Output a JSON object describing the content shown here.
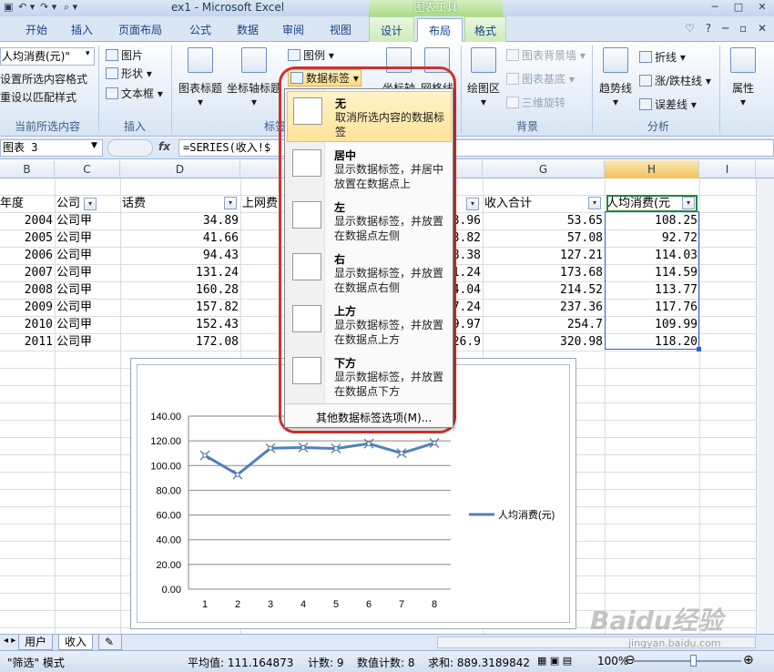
{
  "window": {
    "title": "ex1 - Microsoft Excel",
    "context_tools": "图表工具",
    "controls": [
      "?",
      "─",
      "□",
      "✕"
    ]
  },
  "tabs": [
    {
      "label": "开始"
    },
    {
      "label": "插入"
    },
    {
      "label": "页面布局"
    },
    {
      "label": "公式"
    },
    {
      "label": "数据"
    },
    {
      "label": "审阅"
    },
    {
      "label": "视图"
    },
    {
      "label": "设计"
    },
    {
      "label": "布局"
    },
    {
      "label": "格式"
    }
  ],
  "ribbon": {
    "selection_box": "人均消费(元)\"",
    "format_selection": "设置所选内容格式",
    "reset_style": "重设以匹配样式",
    "group_current": "当前所选内容",
    "picture": "图片",
    "shapes": "形状",
    "textbox": "文本框",
    "group_insert": "插入",
    "chart_title": "图表标题",
    "axis_title": "坐标轴标题",
    "legend": "图例",
    "data_labels": "数据标签",
    "group_labels": "标签",
    "axes": "坐标轴",
    "gridlines": "网格线",
    "plot_area": "绘图区",
    "chart_wall": "图表背景墙",
    "chart_floor": "图表基底",
    "rotation": "三维旋转",
    "group_background": "背景",
    "trendline": "趋势线",
    "lines": "折线",
    "updown": "涨/跌柱线",
    "errorbars": "误差线",
    "group_analysis": "分析",
    "properties": "属性"
  },
  "formula_bar": {
    "name_box": "图表 3",
    "fx": "fx",
    "formula": "=SERIES(收入!$"
  },
  "columns": [
    "B",
    "C",
    "D",
    "",
    "",
    "G",
    "H",
    "I"
  ],
  "table": {
    "headers": {
      "year": "年度",
      "company": "公司",
      "phone": "话费",
      "internet": "上网费",
      "income": "收入合计",
      "per_capita": "人均消费(元"
    },
    "rows": [
      {
        "year": "2004",
        "company": "公司甲",
        "phone": "34.89",
        "partial": "3.96",
        "income": "53.65",
        "per_capita": "108.25"
      },
      {
        "year": "2005",
        "company": "公司甲",
        "phone": "41.66",
        "partial": "3.82",
        "income": "57.08",
        "per_capita": "92.72"
      },
      {
        "year": "2006",
        "company": "公司甲",
        "phone": "94.43",
        "partial": "8.38",
        "income": "127.21",
        "per_capita": "114.03"
      },
      {
        "year": "2007",
        "company": "公司甲",
        "phone": "131.24",
        "partial": "1.24",
        "income": "173.68",
        "per_capita": "114.59"
      },
      {
        "year": "2008",
        "company": "公司甲",
        "phone": "160.28",
        "partial": "4.04",
        "income": "214.52",
        "per_capita": "113.77"
      },
      {
        "year": "2009",
        "company": "公司甲",
        "phone": "157.82",
        "partial": "7.24",
        "income": "237.36",
        "per_capita": "117.76"
      },
      {
        "year": "2010",
        "company": "公司甲",
        "phone": "152.43",
        "partial": "9.97",
        "income": "254.7",
        "per_capita": "109.99"
      },
      {
        "year": "2011",
        "company": "公司甲",
        "phone": "172.08",
        "partial": "26.9",
        "income": "320.98",
        "per_capita": "118.20"
      }
    ]
  },
  "chart_data": {
    "type": "line",
    "x": [
      1,
      2,
      3,
      4,
      5,
      6,
      7,
      8
    ],
    "series": [
      {
        "name": "人均消费(元)",
        "values": [
          108.25,
          92.72,
          114.03,
          114.59,
          113.77,
          117.76,
          109.99,
          118.2
        ],
        "color": "#4f81bd"
      }
    ],
    "ylim": [
      0,
      140
    ],
    "yticks": [
      "0.00",
      "20.00",
      "40.00",
      "60.00",
      "80.00",
      "100.00",
      "120.00",
      "140.00"
    ],
    "xticks": [
      "1",
      "2",
      "3",
      "4",
      "5",
      "6",
      "7",
      "8"
    ],
    "grid": true,
    "legend": "right"
  },
  "dropdown": {
    "items": [
      {
        "title": "无",
        "desc": "取消所选内容的数据标签"
      },
      {
        "title": "居中",
        "desc": "显示数据标签，并居中放置在数据点上"
      },
      {
        "title": "左",
        "desc": "显示数据标签，并放置在数据点左侧"
      },
      {
        "title": "右",
        "desc": "显示数据标签，并放置在数据点右侧"
      },
      {
        "title": "上方",
        "desc": "显示数据标签，并放置在数据点上方"
      },
      {
        "title": "下方",
        "desc": "显示数据标签，并放置在数据点下方"
      }
    ],
    "more": "其他数据标签选项(M)..."
  },
  "sheets": [
    {
      "label": "用户"
    },
    {
      "label": "收入"
    }
  ],
  "status": {
    "mode": "\"筛选\" 模式",
    "average": "平均值: 111.164873",
    "count": "计数: 9",
    "num_count": "数值计数: 8",
    "sum": "求和: 889.3189842",
    "zoom": "100%"
  },
  "watermark": {
    "brand": "Baidu经验",
    "url": "jingyan.baidu.com"
  }
}
